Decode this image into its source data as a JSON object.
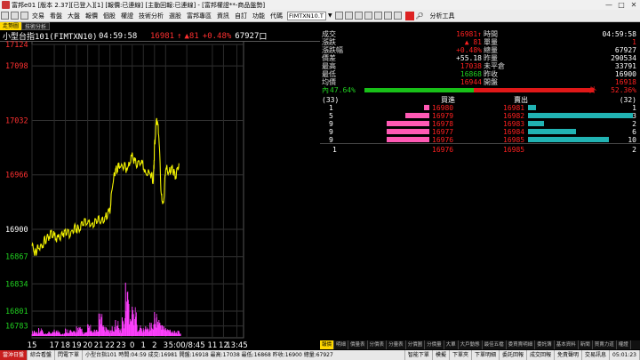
{
  "window": {
    "title": "富邦e01 [版本 2.37][已登入][1] [報價:已連線] [主動回報:已連線] - [富邦權證**-商品盤勢]",
    "minimize": "—",
    "maximize": "□",
    "close": "✕"
  },
  "menu": {
    "items": [
      "交易",
      "看盤",
      "大盤",
      "報價",
      "個股",
      "權證",
      "技術分析",
      "選股",
      "富邦專區",
      "資訊",
      "自訂",
      "功能"
    ],
    "code_label": "代碼",
    "code_value": "FIMTXN10.T",
    "tools_label": "分析工具"
  },
  "subtabs": [
    "走勢圖",
    "技術分析"
  ],
  "header": {
    "symbol": "小型台指101(FIMTXN10)",
    "time": "04:59:58",
    "last": "16981",
    "last_arrow": "↑",
    "change": "▲81",
    "change_pct": "+0.48%",
    "volume": "67927",
    "volume_unit": "口"
  },
  "chart_data": {
    "type": "line",
    "title": "",
    "ylim_price": [
      16773,
      17124
    ],
    "y_ticks": [
      {
        "value": 17124,
        "label": "17124",
        "color": "#ff3030"
      },
      {
        "value": 17098,
        "label": "17098",
        "color": "#ff3030"
      },
      {
        "value": 17032,
        "label": "17032",
        "color": "#ff3030"
      },
      {
        "value": 16966,
        "label": "16966",
        "color": "#ff3030"
      },
      {
        "value": 16900,
        "label": "16900",
        "color": "#ffffff"
      },
      {
        "value": 16867,
        "label": "16867",
        "color": "#20d020"
      },
      {
        "value": 16834,
        "label": "16834",
        "color": "#20d020"
      },
      {
        "value": 16801,
        "label": "16801",
        "color": "#20d020"
      },
      {
        "value": 16783,
        "label": "16783",
        "color": "#20d020"
      }
    ],
    "x_ticks": [
      {
        "t": 0,
        "label": "15"
      },
      {
        "t": 2,
        "label": "17"
      },
      {
        "t": 3,
        "label": "18"
      },
      {
        "t": 4,
        "label": "19"
      },
      {
        "t": 5,
        "label": "20"
      },
      {
        "t": 6,
        "label": "21"
      },
      {
        "t": 7,
        "label": "22"
      },
      {
        "t": 8,
        "label": "23"
      },
      {
        "t": 9,
        "label": "0"
      },
      {
        "t": 10,
        "label": "1"
      },
      {
        "t": 11,
        "label": "2"
      },
      {
        "t": 12,
        "label": "3"
      },
      {
        "t": 13.9,
        "label": "5:00/8:45"
      },
      {
        "t": 16.2,
        "label": "11"
      },
      {
        "t": 17.2,
        "label": "12"
      },
      {
        "t": 18.4,
        "label": "13:45"
      }
    ],
    "x_range": [
      0,
      19
    ],
    "price_series": {
      "name": "",
      "color": "#f2f200",
      "x": [
        0,
        0.3,
        0.6,
        1.0,
        1.4,
        1.8,
        2.2,
        2.6,
        3.0,
        3.4,
        3.8,
        4.2,
        4.6,
        5.0,
        5.4,
        5.8,
        6.2,
        6.6,
        7.0,
        7.3,
        7.5,
        7.8,
        8.2,
        8.6,
        9.0,
        9.4,
        9.8,
        10.2,
        10.6,
        10.9,
        11.0,
        11.2,
        11.4,
        11.6,
        11.8,
        12.0,
        12.3,
        12.6,
        12.9,
        13.2
      ],
      "y": [
        16880,
        16872,
        16878,
        16883,
        16890,
        16895,
        16888,
        16892,
        16898,
        16895,
        16902,
        16900,
        16908,
        16910,
        16905,
        16912,
        16910,
        16915,
        16925,
        16960,
        16972,
        16975,
        16978,
        16972,
        16990,
        16978,
        16985,
        16966,
        16968,
        16960,
        16998,
        17035,
        17015,
        16940,
        16930,
        16975,
        16968,
        16975,
        16965,
        16980
      ]
    },
    "volume_series": {
      "name": "",
      "color": "#ff40ff",
      "x": [
        0.2,
        0.6,
        1.0,
        1.5,
        2.0,
        2.5,
        3.0,
        3.5,
        4.0,
        4.5,
        5.0,
        5.3,
        5.6,
        6.0,
        6.4,
        6.8,
        7.2,
        7.5,
        7.8,
        8.1,
        8.4,
        8.7,
        9.0,
        9.4,
        9.8,
        10.2,
        10.6,
        11.0,
        11.2,
        11.4,
        11.7,
        12.0,
        12.4,
        12.8,
        13.2
      ],
      "y_rel": [
        0.1,
        0.15,
        0.05,
        0.08,
        0.12,
        0.06,
        0.14,
        0.1,
        0.18,
        0.08,
        0.22,
        0.1,
        0.12,
        0.42,
        0.2,
        0.12,
        0.18,
        0.3,
        0.15,
        0.35,
        1.0,
        0.6,
        0.55,
        0.22,
        0.15,
        0.18,
        0.25,
        0.45,
        0.35,
        0.3,
        0.2,
        0.15,
        0.12,
        0.1,
        0.08
      ]
    }
  },
  "quote": {
    "left": [
      {
        "label": "成交",
        "value": "16981↑",
        "color": "red"
      },
      {
        "label": "漲跌",
        "value": "▲ 81",
        "color": "red"
      },
      {
        "label": "漲跌幅",
        "value": "+0.48%",
        "color": "red"
      },
      {
        "label": "價差",
        "value": "+55.18",
        "color": "white"
      },
      {
        "label": "最高",
        "value": "17038",
        "color": "red"
      },
      {
        "label": "最低",
        "value": "16868",
        "color": "green"
      },
      {
        "label": "均價",
        "value": "16944",
        "color": "red"
      }
    ],
    "right": [
      {
        "label": "時間",
        "value": "04:59:58",
        "color": "white"
      },
      {
        "label": "單量",
        "value": "1",
        "color": "red"
      },
      {
        "label": "總量",
        "value": "67927",
        "color": "white"
      },
      {
        "label": "昨量",
        "value": "290534",
        "color": "white"
      },
      {
        "label": "未平倉",
        "value": "33791",
        "color": "white"
      },
      {
        "label": "昨收",
        "value": "16900",
        "color": "white"
      },
      {
        "label": "開盤",
        "value": "16918",
        "color": "red"
      }
    ],
    "in_label": "內",
    "in_pct": "47.64%",
    "in_frac": 0.4764,
    "out_label": "外",
    "out_pct": "52.36%",
    "bid_total": "(33)",
    "ask_total": "(32)",
    "bid_header": "買進",
    "ask_header": "賣出",
    "depth": [
      {
        "bid_qty": "1",
        "bid": "16980",
        "ask": "16981",
        "ask_qty": "1",
        "bid_frac": 0.08,
        "ask_frac": 0.08
      },
      {
        "bid_qty": "5",
        "bid": "16979",
        "ask": "16982",
        "ask_qty": "13",
        "bid_frac": 0.38,
        "ask_frac": 1.0
      },
      {
        "bid_qty": "9",
        "bid": "16978",
        "ask": "16983",
        "ask_qty": "2",
        "bid_frac": 0.69,
        "ask_frac": 0.15
      },
      {
        "bid_qty": "9",
        "bid": "16977",
        "ask": "16984",
        "ask_qty": "6",
        "bid_frac": 0.69,
        "ask_frac": 0.46
      },
      {
        "bid_qty": "9",
        "bid": "16976",
        "ask": "16985",
        "ask_qty": "10",
        "bid_frac": 0.69,
        "ask_frac": 0.77
      }
    ],
    "summary": {
      "bid_qty": "1",
      "bid": "16976",
      "ask": "16985",
      "ask_qty": "2"
    }
  },
  "bottom_tabs": [
    "報價",
    "明細",
    "價量表",
    "分價表",
    "分量表",
    "分價圖",
    "分價量",
    "大單",
    "大戶動態",
    "最佳五檔",
    "委買賣明細",
    "委託簿",
    "基本資料",
    "新聞",
    "買賣力道",
    "權證"
  ],
  "status": {
    "quick_order": "當沖日盤",
    "combo": "綜合看盤",
    "order": "閃電下單",
    "ticker": "小型台指101 時間:04:59 成交:16981 開盤:16918 最高:17038 最低:16868 昨收:16900 總量:67927",
    "items": [
      "智能下單",
      "模擬",
      "下單夾",
      "下單明細",
      "委託回報",
      "成交回報",
      "免責聲明",
      "交易訊息"
    ],
    "clock": "05:01:23"
  },
  "colors": {
    "up": "#ff2020",
    "down": "#20d020",
    "price_line": "#f2f200",
    "volume": "#ff40ff",
    "tab_active": "#ffd800"
  }
}
